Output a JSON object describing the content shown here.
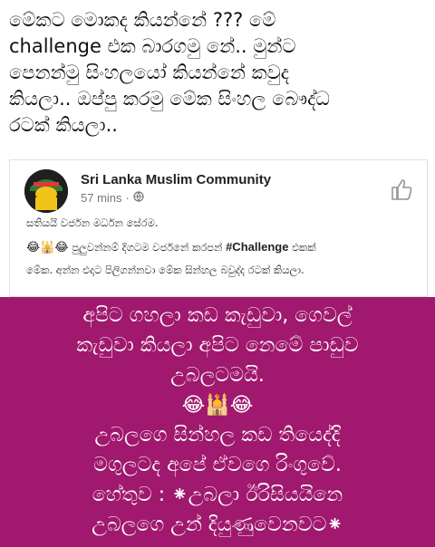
{
  "caption": {
    "text": "මේකට මොකද කියන්නේ ??? මේ\nchallenge එක බාරගමු නේ.. මුන්ට\nපෙනන්මු සිංහලයෝ කියන්නේ කවුද\nකියලා.. ඔප්පු කරමු මේක සිංහල බෞද්ධ\nරටක් කියලා.."
  },
  "shared_post": {
    "page_name": "Sri Lanka Muslim Community",
    "time": "57 mins",
    "separator": "·",
    "line1": "සතියයි වර්ජන මර්ධන සේරම.",
    "line2_emoji": "😂🕌😂",
    "line2_text": "පුලුවන්නම් දිගටම වර්ජනේ කරපන්",
    "line2_hashtag": "#Challenge",
    "line2_end": "එකක්",
    "line3": "මේක. අන්න එදාට පිලිගන්නවා මේක සින්හල බවුද්ද රටක් කියලා."
  },
  "banner": {
    "text": "අපිට ගහලා කඩ කැඩුවා, ගෙවල්\nකැඩුවා කියලා අපිට නෙමේ පාඩුව\nඋබලටමයි.\n😂🕌😂\nඋබලගෙ සින්හල කඩ තියෙද්දි\nමගුලටද අපේ ඒවගෙ රිංගුවේ.\nහේතුව : ⁕උබලා ඊරිසියයිනෙ\nඋබලගෙ උන් දියුණුවෙනවට⁕",
    "color": "#a0196e"
  },
  "icons": {
    "globe": "globe-icon",
    "like": "thumbs-up-icon",
    "avatar": "page-avatar"
  }
}
